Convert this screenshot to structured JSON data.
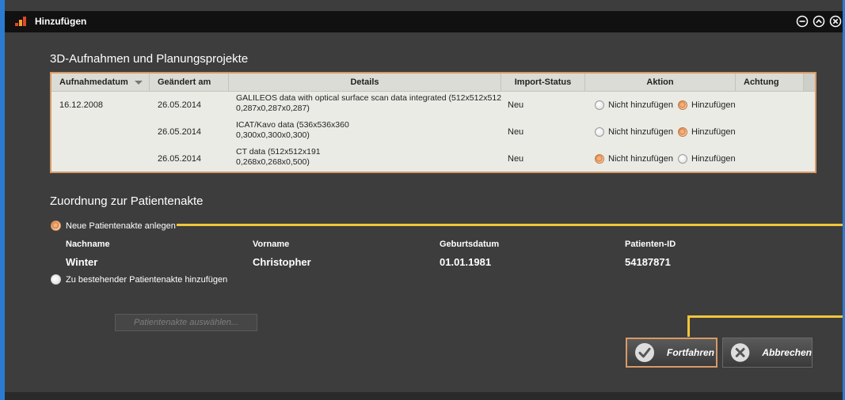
{
  "window": {
    "title": "Hinzufügen"
  },
  "section_scans": {
    "title": "3D-Aufnahmen und Planungsprojekte",
    "columns": [
      "Aufnahmedatum",
      "Geändert am",
      "Details",
      "Import-Status",
      "Aktion",
      "Achtung"
    ],
    "rows": [
      {
        "date": "16.12.2008",
        "changed": "26.05.2014",
        "details_line1": "GALILEOS data with optical surface scan data integrated (512x512x512",
        "details_line2": "0,287x0,287x0,287)",
        "status": "Neu",
        "opt_skip": "Nicht hinzufügen",
        "opt_add": "Hinzufügen",
        "selected": "add"
      },
      {
        "date": "",
        "changed": "26.05.2014",
        "details_line1": "ICAT/Kavo data (536x536x360",
        "details_line2": "0,300x0,300x0,300)",
        "status": "Neu",
        "opt_skip": "Nicht hinzufügen",
        "opt_add": "Hinzufügen",
        "selected": "add"
      },
      {
        "date": "",
        "changed": "26.05.2014",
        "details_line1": "CT data (512x512x191",
        "details_line2": "0,268x0,268x0,500)",
        "status": "Neu",
        "opt_skip": "Nicht hinzufügen",
        "opt_add": "Hinzufügen",
        "selected": "skip"
      }
    ]
  },
  "section_patient": {
    "title": "Zuordnung zur Patientenakte",
    "option_new": "Neue Patientenakte anlegen",
    "option_existing": "Zu bestehender Patientenakte hinzufügen",
    "selected": "new",
    "labels": {
      "lastname": "Nachname",
      "firstname": "Vorname",
      "birthdate": "Geburtsdatum",
      "patient_id": "Patienten-ID"
    },
    "values": {
      "lastname": "Winter",
      "firstname": "Christopher",
      "birthdate": "01.01.1981",
      "patient_id": "54187871"
    },
    "select_button": "Patientenakte auswählen..."
  },
  "buttons": {
    "continue": "Fortfahren",
    "cancel": "Abbrechen"
  },
  "colors": {
    "accent_orange": "#d79a66",
    "highlight_yellow": "#f2c63a",
    "window_frame": "#2c7bd1"
  }
}
